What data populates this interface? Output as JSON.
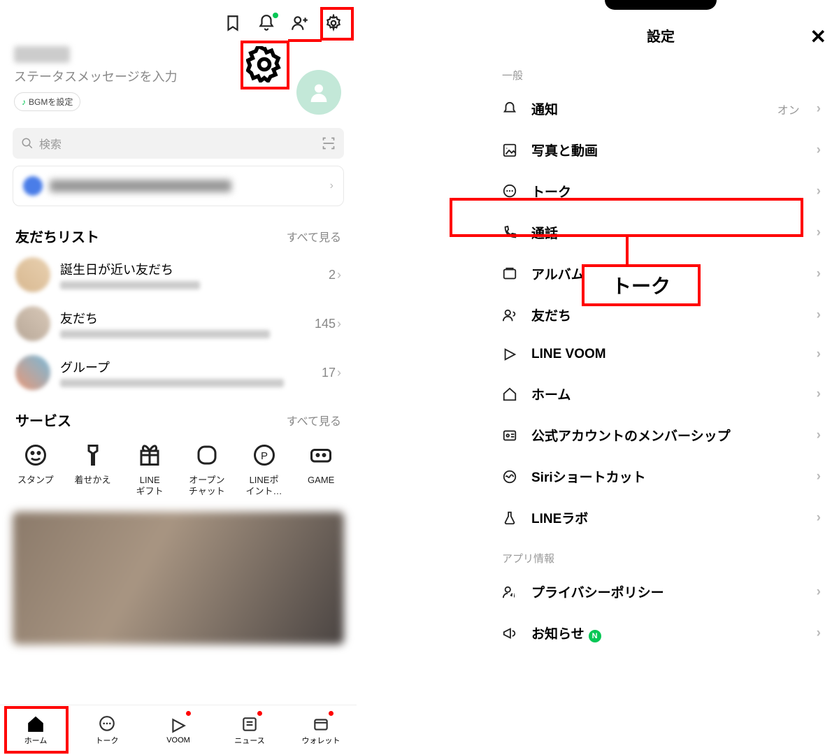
{
  "left": {
    "status_placeholder": "ステータスメッセージを入力",
    "bgm": "BGMを設定",
    "search_placeholder": "検索",
    "friend_list_title": "友だちリスト",
    "see_all": "すべて見る",
    "friends": [
      {
        "name": "誕生日が近い友だち",
        "count": "2"
      },
      {
        "name": "友だち",
        "count": "145"
      },
      {
        "name": "グループ",
        "count": "17"
      }
    ],
    "services_title": "サービス",
    "services": [
      {
        "label": "スタンプ"
      },
      {
        "label": "着せかえ"
      },
      {
        "label": "LINE\nギフト"
      },
      {
        "label": "オープン\nチャット"
      },
      {
        "label": "LINEポ\nイント…"
      },
      {
        "label": "GAME"
      }
    ],
    "tabs": [
      {
        "label": "ホーム"
      },
      {
        "label": "トーク"
      },
      {
        "label": "VOOM"
      },
      {
        "label": "ニュース"
      },
      {
        "label": "ウォレット"
      }
    ]
  },
  "right": {
    "title": "設定",
    "section_general": "一般",
    "rows": [
      {
        "label": "通知",
        "value": "オン",
        "icon": "bell"
      },
      {
        "label": "写真と動画",
        "icon": "image"
      },
      {
        "label": "トーク",
        "icon": "chat"
      },
      {
        "label": "通話",
        "icon": "phone"
      },
      {
        "label": "アルバム",
        "icon": "album"
      },
      {
        "label": "友だち",
        "icon": "friend"
      },
      {
        "label": "LINE VOOM",
        "icon": "voom"
      },
      {
        "label": "ホーム",
        "icon": "home"
      },
      {
        "label": "公式アカウントのメンバーシップ",
        "icon": "member"
      },
      {
        "label": "Siriショートカット",
        "icon": "siri"
      },
      {
        "label": "LINEラボ",
        "icon": "flask"
      }
    ],
    "section_app": "アプリ情報",
    "rows2": [
      {
        "label": "プライバシーポリシー",
        "icon": "privacy"
      },
      {
        "label": "お知らせ",
        "icon": "announce",
        "badge": "N"
      }
    ]
  },
  "annotation": {
    "talk_label": "トーク"
  }
}
